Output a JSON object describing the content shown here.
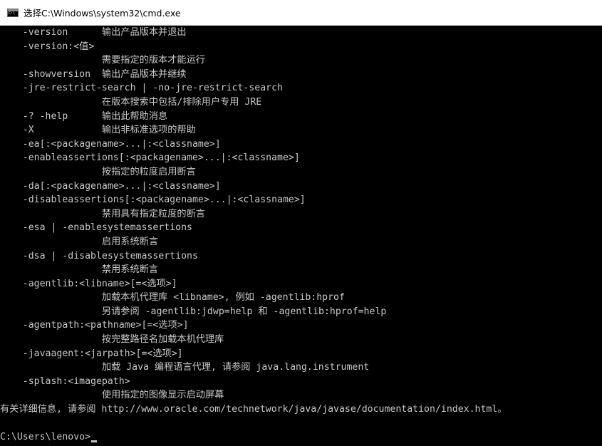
{
  "window": {
    "title": "选择C:\\Windows\\system32\\cmd.exe",
    "icon": "cmd-icon"
  },
  "console": {
    "lines": [
      "    -version      输出产品版本并退出",
      "    -version:<值>",
      "                  需要指定的版本才能运行",
      "    -showversion  输出产品版本并继续",
      "    -jre-restrict-search | -no-jre-restrict-search",
      "                  在版本搜索中包括/排除用户专用 JRE",
      "    -? -help      输出此帮助消息",
      "    -X            输出非标准选项的帮助",
      "    -ea[:<packagename>...|:<classname>]",
      "    -enableassertions[:<packagename>...|:<classname>]",
      "                  按指定的粒度启用断言",
      "    -da[:<packagename>...|:<classname>]",
      "    -disableassertions[:<packagename>...|:<classname>]",
      "                  禁用具有指定粒度的断言",
      "    -esa | -enablesystemassertions",
      "                  启用系统断言",
      "    -dsa | -disablesystemassertions",
      "                  禁用系统断言",
      "    -agentlib:<libname>[=<选项>]",
      "                  加载本机代理库 <libname>, 例如 -agentlib:hprof",
      "                  另请参阅 -agentlib:jdwp=help 和 -agentlib:hprof=help",
      "    -agentpath:<pathname>[=<选项>]",
      "                  按完整路径名加载本机代理库",
      "    -javaagent:<jarpath>[=<选项>]",
      "                  加载 Java 编程语言代理, 请参阅 java.lang.instrument",
      "    -splash:<imagepath>",
      "                  使用指定的图像显示启动屏幕",
      "有关详细信息, 请参阅 http://www.oracle.com/technetwork/java/javase/documentation/index.html。"
    ],
    "prompt": "C:\\Users\\lenovo>"
  }
}
